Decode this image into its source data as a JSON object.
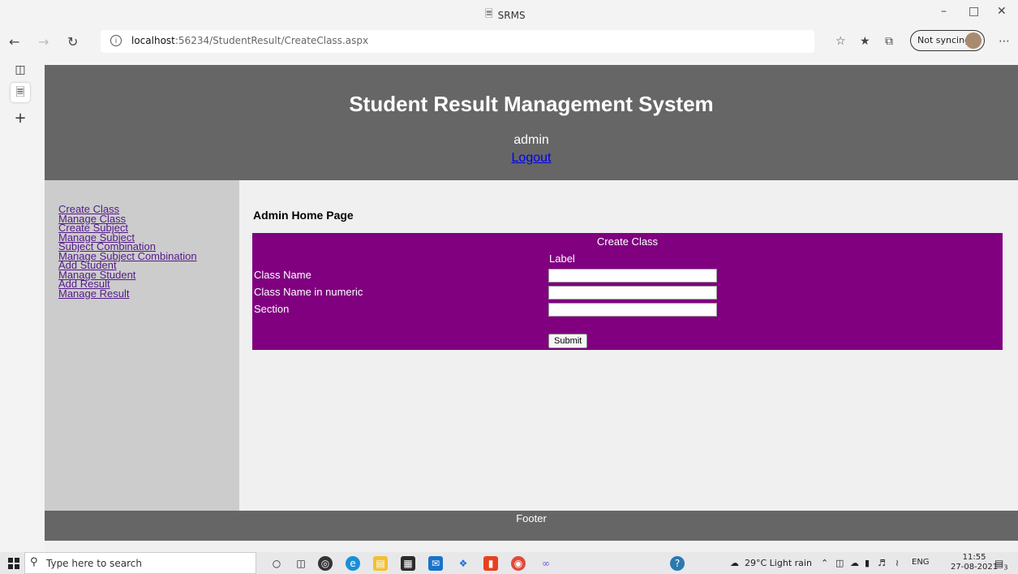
{
  "browser": {
    "tab_title": "SRMS",
    "url_host": "localhost",
    "url_rest": ":56234/StudentResult/CreateClass.aspx",
    "sync_label": "Not syncing"
  },
  "header": {
    "title": "Student Result Management System",
    "user": "admin",
    "logout": "Logout"
  },
  "sidebar": {
    "items": [
      {
        "label": "Create Class"
      },
      {
        "label": "Manage Class"
      },
      {
        "label": "Create Subject"
      },
      {
        "label": "Manage Subject"
      },
      {
        "label": "Subject Combination"
      },
      {
        "label": "Manage Subject Combination"
      },
      {
        "label": "Add Student"
      },
      {
        "label": "Manage Student"
      },
      {
        "label": "Add Result"
      },
      {
        "label": "Manage Result"
      }
    ]
  },
  "main": {
    "heading": "Admin Home Page",
    "form": {
      "title": "Create Class",
      "label": "Label",
      "fields": [
        {
          "label": "Class Name",
          "value": ""
        },
        {
          "label": "Class Name in numeric",
          "value": ""
        },
        {
          "label": "Section",
          "value": ""
        }
      ],
      "submit": "Submit"
    }
  },
  "footer": {
    "text": "Footer"
  },
  "taskbar": {
    "search_placeholder": "Type here to search",
    "weather": "29°C  Light rain",
    "language": "ENG",
    "time": "11:55",
    "date": "27-08-2021",
    "notification_count": "3"
  }
}
